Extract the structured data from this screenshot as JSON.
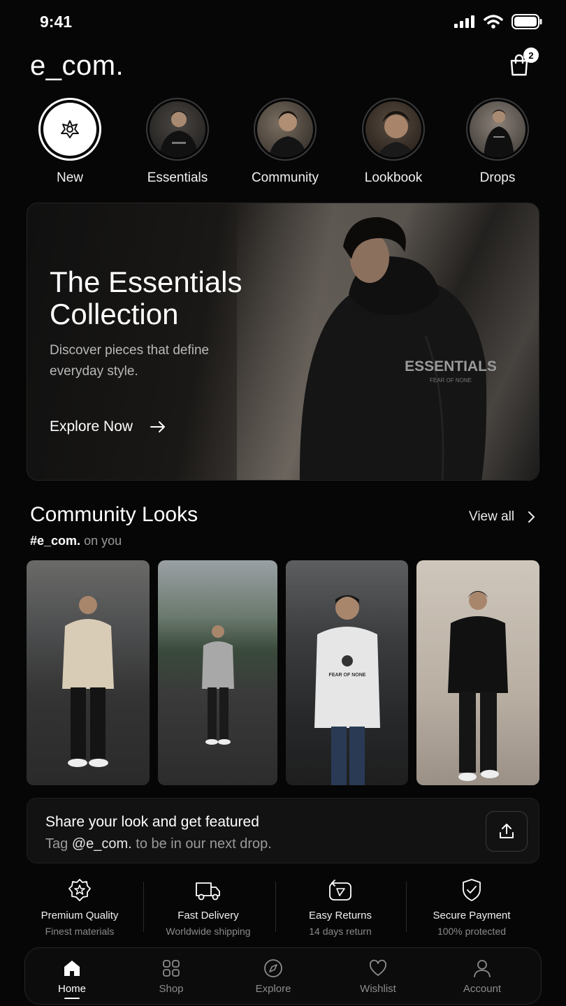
{
  "status_bar": {
    "time": "9:41",
    "icons": [
      "signal-icon",
      "wifi-icon",
      "battery-icon"
    ]
  },
  "header": {
    "brand": "e_com.",
    "cart_count": "2"
  },
  "stories": [
    {
      "label": "New"
    },
    {
      "label": "Essentials"
    },
    {
      "label": "Community"
    },
    {
      "label": "Lookbook"
    },
    {
      "label": "Drops"
    }
  ],
  "hero": {
    "title": "The Essentials Collection",
    "subtitle": "Discover pieces that define everyday style.",
    "cta": "Explore Now",
    "print": "ESSENTIALS",
    "print_sub": "FEAR OF NONE"
  },
  "community": {
    "title": "Community Looks",
    "hashtag": "#e_com.",
    "hashtag_suffix": "on you",
    "view_all": "View all",
    "photo_print": "FEAR OF NONE"
  },
  "share": {
    "title": "Share your look and get featured",
    "sub_prefix": "Tag",
    "handle": "@e_com.",
    "sub_suffix": "to be in our next drop."
  },
  "features": [
    {
      "title": "Premium Quality",
      "sub": "Finest materials",
      "icon": "star-badge-icon"
    },
    {
      "title": "Fast Delivery",
      "sub": "Worldwide shipping",
      "icon": "truck-icon"
    },
    {
      "title": "Easy Returns",
      "sub": "14 days return",
      "icon": "return-box-icon"
    },
    {
      "title": "Secure Payment",
      "sub": "100% protected",
      "icon": "shield-check-icon"
    }
  ],
  "tabs": [
    {
      "label": "Home",
      "icon": "home-icon"
    },
    {
      "label": "Shop",
      "icon": "grid-icon"
    },
    {
      "label": "Explore",
      "icon": "compass-icon"
    },
    {
      "label": "Wishlist",
      "icon": "heart-icon"
    },
    {
      "label": "Account",
      "icon": "user-icon"
    }
  ]
}
